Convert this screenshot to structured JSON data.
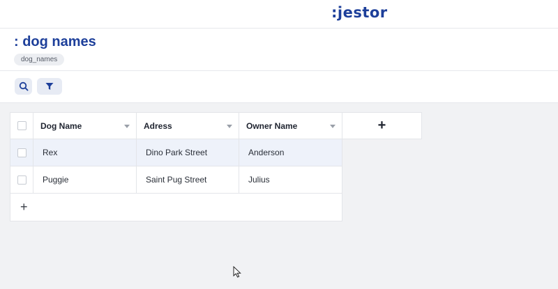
{
  "app": {
    "logo": ":jestor"
  },
  "page": {
    "title": ": dog names",
    "slug": "dog_names"
  },
  "toolbar": {
    "search_icon": "search-icon",
    "filter_icon": "filter-icon"
  },
  "table": {
    "columns": [
      "Dog Name",
      "Adress",
      "Owner Name"
    ],
    "add_column_label": "+",
    "add_row_label": "+",
    "rows": [
      [
        "Rex",
        "Dino Park Street",
        "Anderson"
      ],
      [
        "Puggie",
        "Saint Pug Street",
        "Julius"
      ]
    ]
  },
  "colors": {
    "brand": "#1d3f9a",
    "row_highlight": "#eef2fa"
  }
}
